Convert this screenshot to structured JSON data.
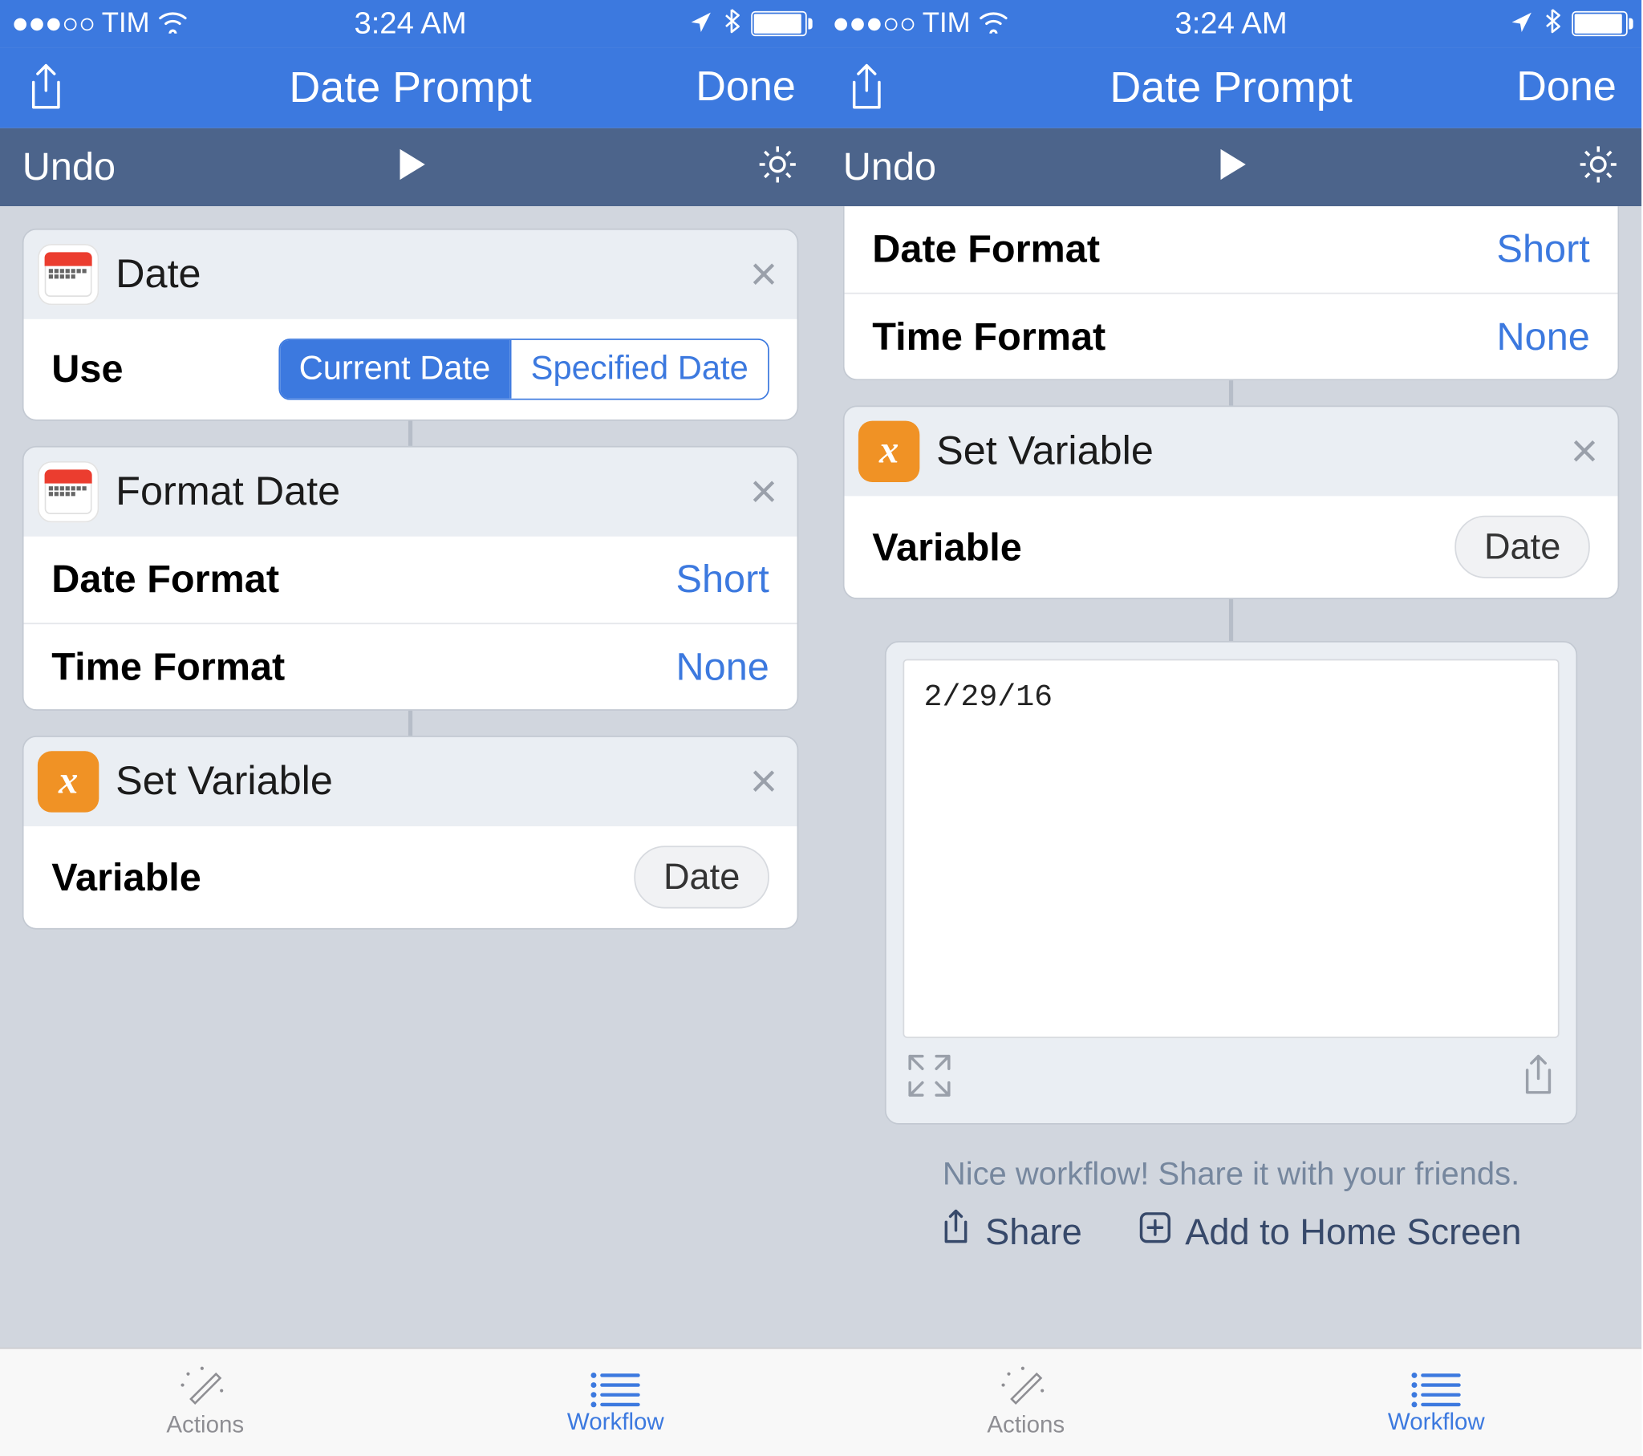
{
  "statusbar": {
    "carrier": "TIM",
    "time": "3:24 AM"
  },
  "header": {
    "title": "Date Prompt",
    "done": "Done"
  },
  "secbar": {
    "undo": "Undo"
  },
  "actions": {
    "date": {
      "title": "Date",
      "use_label": "Use",
      "seg_current": "Current Date",
      "seg_specified": "Specified Date"
    },
    "format_date": {
      "title": "Format Date",
      "date_format_label": "Date Format",
      "date_format_value": "Short",
      "time_format_label": "Time Format",
      "time_format_value": "None"
    },
    "set_variable": {
      "title": "Set Variable",
      "variable_label": "Variable",
      "variable_value": "Date"
    }
  },
  "result": {
    "text": "2/29/16"
  },
  "footer": {
    "nice": "Nice workflow! Share it with your friends.",
    "share": "Share",
    "add_home": "Add to Home Screen"
  },
  "tabs": {
    "actions": "Actions",
    "workflow": "Workflow"
  }
}
